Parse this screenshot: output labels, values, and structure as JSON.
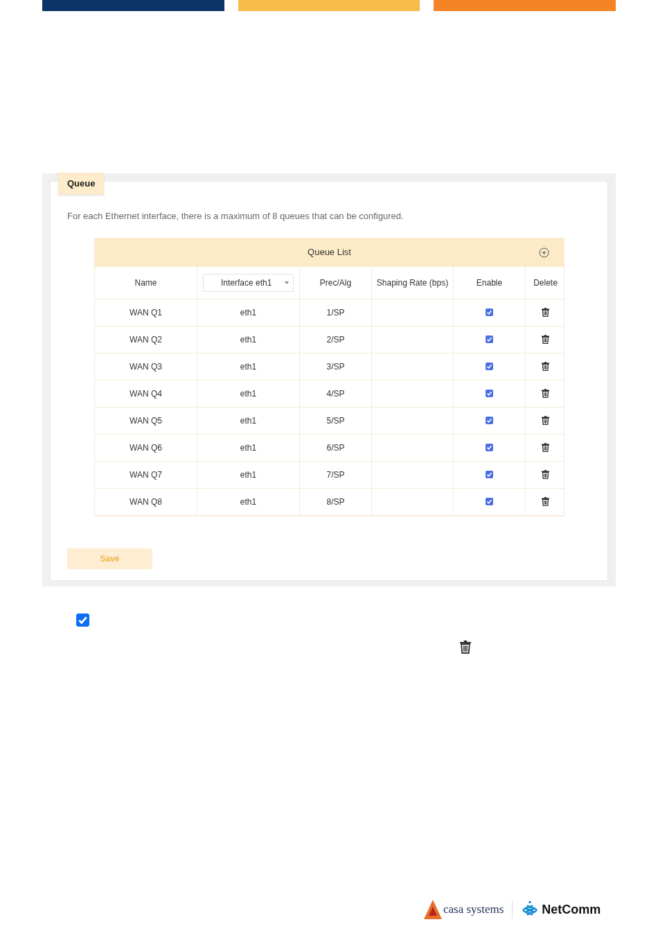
{
  "header_bars": [
    {
      "color": "#0d3466"
    },
    {
      "color": "#f7bb48"
    },
    {
      "color": "#f58426"
    }
  ],
  "panel": {
    "tab": "Queue",
    "description": "For each Ethernet interface, there is a maximum of 8 queues that can be configured.",
    "table": {
      "title": "Queue List",
      "interface_select": "Interface eth1",
      "columns": [
        "Name",
        "Prec/Alg",
        "Shaping Rate (bps)",
        "Enable",
        "Delete"
      ],
      "rows": [
        {
          "name": "WAN Q1",
          "interface": "eth1",
          "prec": "1/SP",
          "enabled": true
        },
        {
          "name": "WAN Q2",
          "interface": "eth1",
          "prec": "2/SP",
          "enabled": true
        },
        {
          "name": "WAN Q3",
          "interface": "eth1",
          "prec": "3/SP",
          "enabled": true
        },
        {
          "name": "WAN Q4",
          "interface": "eth1",
          "prec": "4/SP",
          "enabled": true
        },
        {
          "name": "WAN Q5",
          "interface": "eth1",
          "prec": "5/SP",
          "enabled": true
        },
        {
          "name": "WAN Q6",
          "interface": "eth1",
          "prec": "6/SP",
          "enabled": true
        },
        {
          "name": "WAN Q7",
          "interface": "eth1",
          "prec": "7/SP",
          "enabled": true
        },
        {
          "name": "WAN Q8",
          "interface": "eth1",
          "prec": "8/SP",
          "enabled": true
        }
      ]
    },
    "save_button": "Save"
  },
  "legend": {
    "checkbox_checked": true
  },
  "footer": {
    "logos": [
      "casa systems",
      "NetComm"
    ]
  }
}
